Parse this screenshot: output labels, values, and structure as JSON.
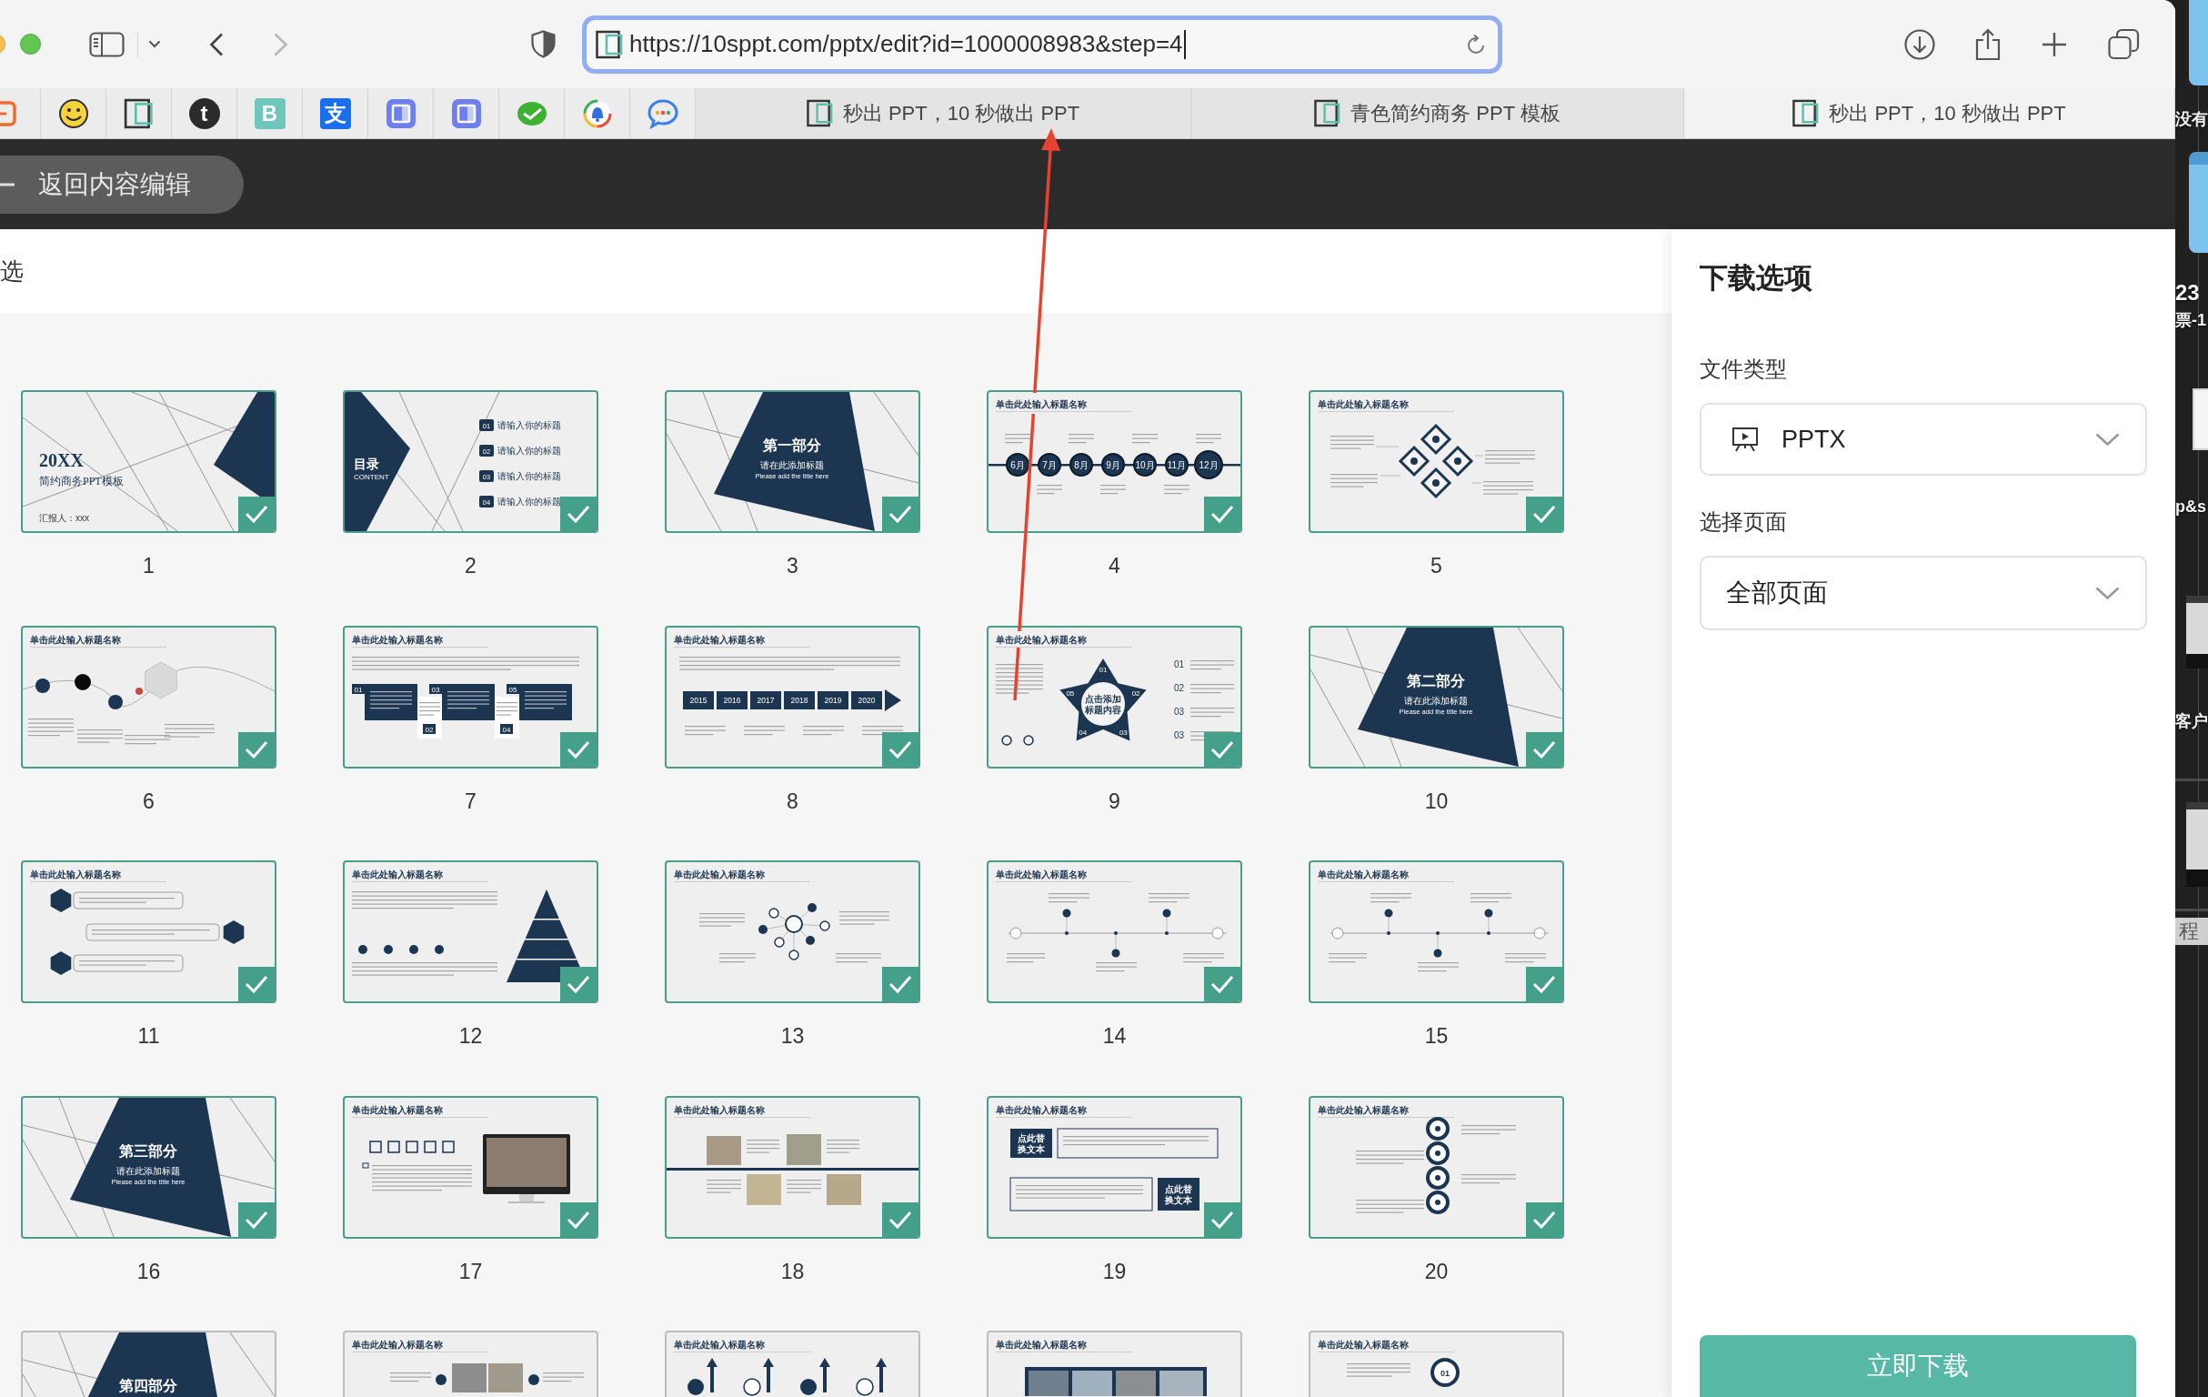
{
  "browser": {
    "back_disabled": false,
    "forward_disabled": true,
    "url": "https://10sppt.com/pptx/edit?id=1000008983&step=4",
    "bookmarks": [
      {
        "kind": "bracket"
      },
      {
        "kind": "smiley"
      },
      {
        "kind": "logo"
      },
      {
        "kind": "badge",
        "glyph": "t",
        "color": "#2b2b2b"
      },
      {
        "kind": "tile",
        "glyph": "B",
        "color": "#6ec6bd"
      },
      {
        "kind": "tile",
        "glyph": "支",
        "color": "#1a6ff0"
      },
      {
        "kind": "window"
      },
      {
        "kind": "window"
      },
      {
        "kind": "chat"
      },
      {
        "kind": "bell"
      },
      {
        "kind": "bubble"
      }
    ],
    "tabs": [
      {
        "title": "秒出 PPT，10 秒做出 PPT",
        "selected": false
      },
      {
        "title": "青色简约商务 PPT 模板",
        "selected": false
      },
      {
        "title": "秒出 PPT，10 秒做出 PPT",
        "selected": true
      }
    ]
  },
  "app_bar": {
    "back_label": "返回内容编辑"
  },
  "toolbar": {
    "select_all_label": "选"
  },
  "slides": [
    {
      "number": "1",
      "selected": true,
      "kind": "cover",
      "title": "20XX",
      "subtitle": "简约商务PPT模板",
      "presenter": "汇报人：xxx"
    },
    {
      "number": "2",
      "selected": true,
      "kind": "contents",
      "title": "目录",
      "caption": "CONTENT",
      "items": [
        {
          "index": "01",
          "text": "请输入你的标题"
        },
        {
          "index": "02",
          "text": "请输入你的标题"
        },
        {
          "index": "03",
          "text": "请输入你的标题"
        },
        {
          "index": "04",
          "text": "请输入你的标题"
        }
      ]
    },
    {
      "number": "3",
      "selected": true,
      "kind": "section",
      "title": "第一部分",
      "subtitle": "请在此添加标题",
      "caption": "Please add the title here"
    },
    {
      "number": "4",
      "selected": true,
      "kind": "timeline",
      "header": "单击此处输入标题名称",
      "labels": [
        "6月",
        "7月",
        "8月",
        "9月",
        "10月",
        "11月",
        "12月"
      ]
    },
    {
      "number": "5",
      "selected": true,
      "kind": "diamond",
      "header": "单击此处输入标题名称"
    },
    {
      "number": "6",
      "selected": true,
      "kind": "nodes",
      "header": "单击此处输入标题名称"
    },
    {
      "number": "7",
      "selected": true,
      "kind": "columns",
      "header": "单击此处输入标题名称",
      "labels": [
        "01",
        "02",
        "03",
        "04",
        "05"
      ]
    },
    {
      "number": "8",
      "selected": true,
      "kind": "steps",
      "header": "单击此处输入标题名称",
      "labels": [
        "2015",
        "2016",
        "2017",
        "2018",
        "2019",
        "2020"
      ]
    },
    {
      "number": "9",
      "selected": true,
      "kind": "star",
      "header": "单击此处输入标题名称",
      "labels": [
        "01",
        "02",
        "03",
        "04",
        "05"
      ],
      "center": "点击添加标题内容",
      "side_labels": [
        "01",
        "02",
        "03",
        "03"
      ]
    },
    {
      "number": "10",
      "selected": true,
      "kind": "section",
      "title": "第二部分",
      "subtitle": "请在此添加标题",
      "caption": "Please add the title here"
    },
    {
      "number": "11",
      "selected": true,
      "kind": "hexagons",
      "header": "单击此处输入标题名称"
    },
    {
      "number": "12",
      "selected": true,
      "kind": "pyramid",
      "header": "单击此处输入标题名称"
    },
    {
      "number": "13",
      "selected": true,
      "kind": "network",
      "header": "单击此处输入标题名称"
    },
    {
      "number": "14",
      "selected": true,
      "kind": "dots",
      "header": "单击此处输入标题名称"
    },
    {
      "number": "15",
      "selected": true,
      "kind": "dots",
      "header": "单击此处输入标题名称"
    },
    {
      "number": "16",
      "selected": true,
      "kind": "section",
      "title": "第三部分",
      "subtitle": "请在此添加标题",
      "caption": "Please add the title here"
    },
    {
      "number": "17",
      "selected": true,
      "kind": "monitor",
      "header": "单击此处输入标题名称"
    },
    {
      "number": "18",
      "selected": true,
      "kind": "gallery",
      "header": "单击此处输入标题名称"
    },
    {
      "number": "19",
      "selected": true,
      "kind": "boxes",
      "header": "单击此处输入标题名称",
      "labels": [
        "点此替换文本",
        "点此替换文本"
      ]
    },
    {
      "number": "20",
      "selected": true,
      "kind": "chain",
      "header": "单击此处输入标题名称"
    },
    {
      "kind": "section",
      "title": "第四部分"
    },
    {
      "kind": "photos",
      "header": "单击此处输入标题名称"
    },
    {
      "kind": "arrows",
      "header": "单击此处输入标题名称"
    },
    {
      "kind": "strip",
      "header": "单击此处输入标题名称"
    },
    {
      "kind": "ring",
      "header": "单击此处输入标题名称",
      "labels": [
        "01"
      ]
    }
  ],
  "download_panel": {
    "title": "下载选项",
    "file_type_label": "文件类型",
    "file_type_value": "PPTX",
    "pages_label": "选择页面",
    "pages_value": "全部页面",
    "button": "立即下载"
  },
  "desktop": {
    "labels": [
      {
        "text": "没有",
        "kind": "name"
      },
      {
        "text": "23",
        "kind": "name"
      },
      {
        "text": "票-1",
        "kind": "name"
      },
      {
        "text": "p&s",
        "kind": "name"
      },
      {
        "text": "客户",
        "kind": "name"
      },
      {
        "text": "程",
        "kind": "tag"
      }
    ]
  }
}
